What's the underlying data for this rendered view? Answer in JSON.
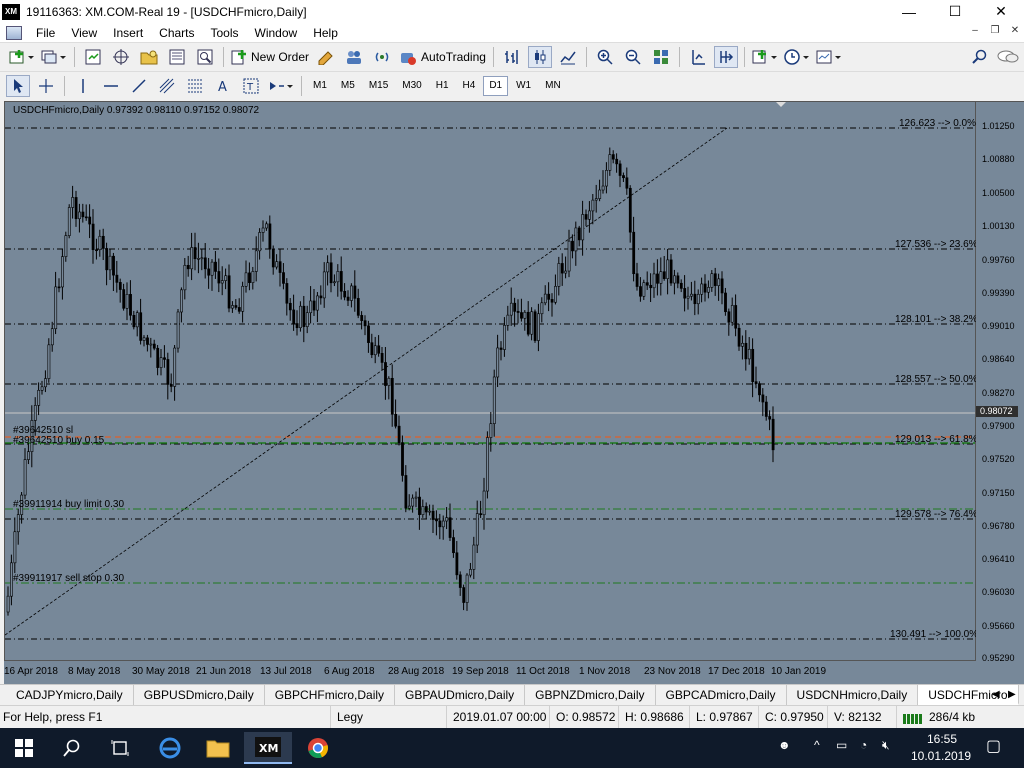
{
  "window": {
    "title": "19116363: XM.COM-Real 19 - [USDCHFmicro,Daily]",
    "logo_text": "XM",
    "minimize_glyph": "—",
    "maximize_glyph": "☐",
    "close_glyph": "✕"
  },
  "menu": {
    "items": [
      "File",
      "View",
      "Insert",
      "Charts",
      "Tools",
      "Window",
      "Help"
    ],
    "mdi_min": "–",
    "mdi_restore": "❐",
    "mdi_close": "✕"
  },
  "toolbar": {
    "new_order": "New Order",
    "autotrading": "AutoTrading"
  },
  "timeframes": [
    "M1",
    "M5",
    "M15",
    "M30",
    "H1",
    "H4",
    "D1",
    "W1",
    "MN"
  ],
  "active_timeframe": "D1",
  "chart": {
    "header": "USDCHFmicro,Daily  0.97392 0.98110 0.97152 0.98072",
    "current_price": "0.98072",
    "price_labels": [
      "1.01250",
      "1.00880",
      "1.00500",
      "1.00130",
      "0.99760",
      "0.99390",
      "0.99010",
      "0.98640",
      "0.98270",
      "0.97900",
      "0.97520",
      "0.97150",
      "0.96780",
      "0.96410",
      "0.96030",
      "0.95660",
      "0.95290"
    ],
    "time_labels": [
      "16 Apr 2018",
      "8 May 2018",
      "30 May 2018",
      "21 Jun 2018",
      "13 Jul 2018",
      "6 Aug 2018",
      "28 Aug 2018",
      "19 Sep 2018",
      "11 Oct 2018",
      "1 Nov 2018",
      "23 Nov 2018",
      "17 Dec 2018",
      "10 Jan 2019"
    ],
    "fib_levels": [
      {
        "label": "126.623 --> 0.0%"
      },
      {
        "label": "127.536 --> 23.6%"
      },
      {
        "label": "128.101 --> 38.2%"
      },
      {
        "label": "128.557 --> 50.0%"
      },
      {
        "label": "129.013 --> 61.8%"
      },
      {
        "label": "129.578 --> 76.4%"
      },
      {
        "label": "130.491 --> 100.0%"
      }
    ],
    "orders": {
      "sl": "#39642510 sl",
      "buy": "#39642510 buy 0.15",
      "buy_limit": "#39911914 buy limit 0.30",
      "sell_stop": "#39911917 sell stop 0.30"
    },
    "colors": {
      "background": "#778899",
      "candle": "#000000",
      "sl_line": "#e0602a",
      "order_line": "#1f7a1f",
      "fib_line": "#000000"
    }
  },
  "tabs": {
    "items": [
      "CADJPYmicro,Daily",
      "GBPUSDmicro,Daily",
      "GBPCHFmicro,Daily",
      "GBPAUDmicro,Daily",
      "GBPNZDmicro,Daily",
      "GBPCADmicro,Daily",
      "USDCNHmicro,Daily",
      "USDCHFmicro"
    ],
    "active": "USDCHFmicro"
  },
  "status": {
    "help": "For Help, press F1",
    "profile": "Legy",
    "datetime": "2019.01.07 00:00",
    "open": "O: 0.98572",
    "high": "H: 0.98686",
    "low": "L: 0.97867",
    "close": "C: 0.97950",
    "volume": "V: 82132",
    "traffic": "286/4 kb"
  },
  "taskbar": {
    "time": "16:55",
    "date": "10.01.2019"
  }
}
